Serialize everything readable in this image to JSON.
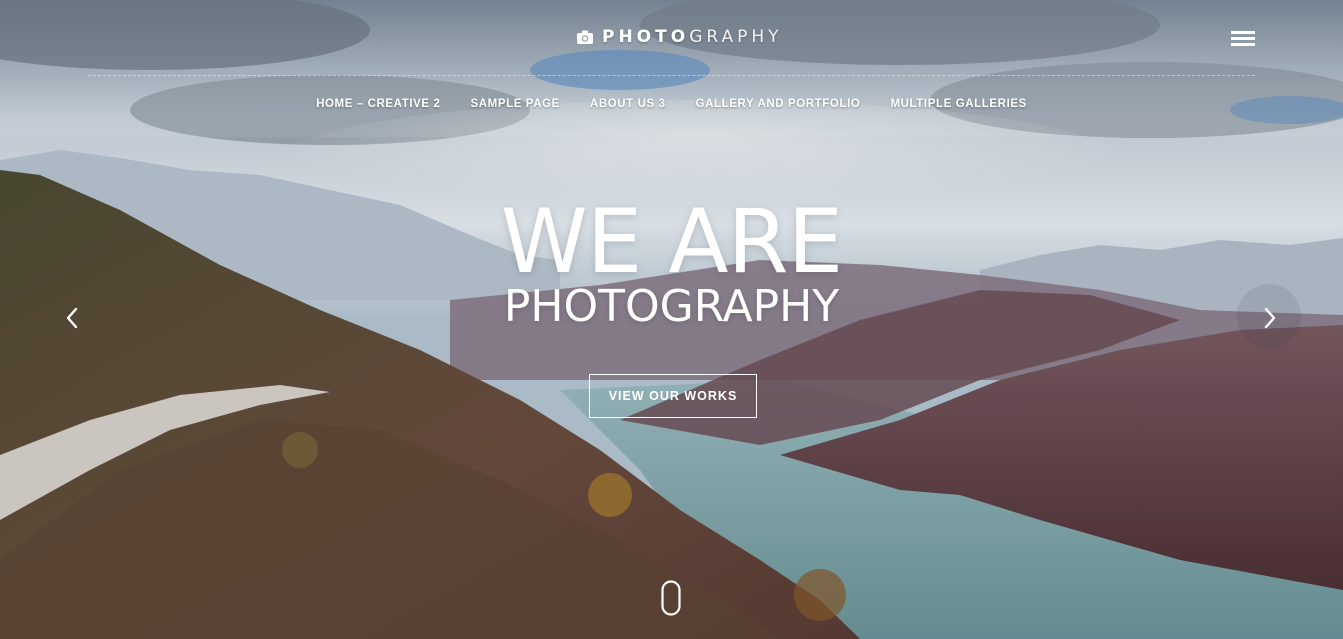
{
  "header": {
    "logo_bold": "PHOTO",
    "logo_light": "GRAPHY",
    "logo_icon": "camera-icon",
    "menu_icon": "hamburger-menu-icon"
  },
  "nav": {
    "items": [
      {
        "label": "HOME – CREATIVE 2"
      },
      {
        "label": "SAMPLE PAGE"
      },
      {
        "label": "ABOUT US 3"
      },
      {
        "label": "GALLERY AND PORTFOLIO"
      },
      {
        "label": "MULTIPLE GALLERIES"
      }
    ]
  },
  "hero": {
    "headline": "WE ARE",
    "subheadline": "PHOTOGRAPHY",
    "cta_label": "VIEW OUR WORKS",
    "prev_icon": "chevron-left-icon",
    "next_icon": "chevron-right-icon",
    "scroll_icon": "mouse-scroll-icon"
  },
  "colors": {
    "text": "#ffffff",
    "sky": "#a9bccb",
    "water": "#7fa9ac",
    "hills": "#6e4a4a"
  }
}
